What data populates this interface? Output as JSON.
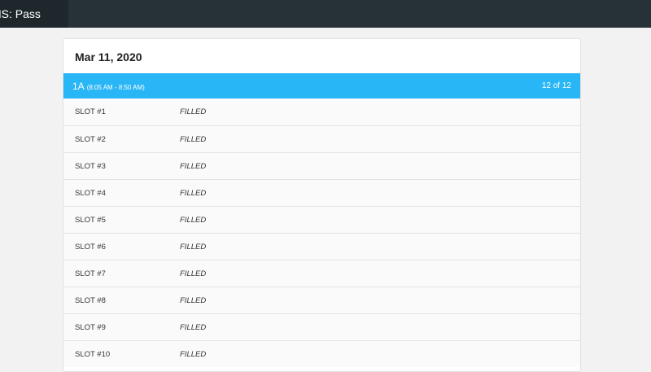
{
  "topbar": {
    "title": "MS: Pass"
  },
  "card": {
    "date": "Mar 11, 2020",
    "period": {
      "name": "1A",
      "time": "(8:05 AM - 8:50 AM)",
      "count": "12 of 12"
    },
    "slots": [
      {
        "label": "SLOT #1",
        "status": "FILLED"
      },
      {
        "label": "SLOT #2",
        "status": "FILLED"
      },
      {
        "label": "SLOT #3",
        "status": "FILLED"
      },
      {
        "label": "SLOT #4",
        "status": "FILLED"
      },
      {
        "label": "SLOT #5",
        "status": "FILLED"
      },
      {
        "label": "SLOT #6",
        "status": "FILLED"
      },
      {
        "label": "SLOT #7",
        "status": "FILLED"
      },
      {
        "label": "SLOT #8",
        "status": "FILLED"
      },
      {
        "label": "SLOT #9",
        "status": "FILLED"
      },
      {
        "label": "SLOT #10",
        "status": "FILLED"
      }
    ]
  },
  "colors": {
    "topbar": "#263238",
    "accent": "#29b6f6"
  }
}
